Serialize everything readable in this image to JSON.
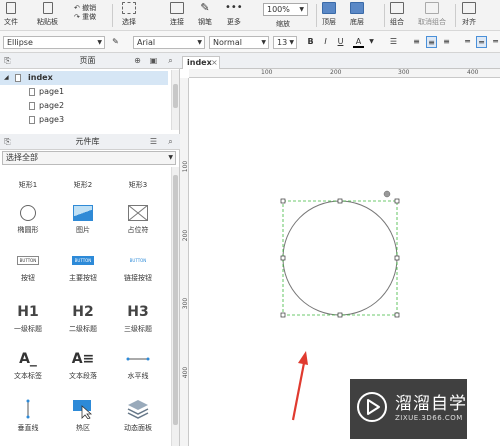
{
  "toolbar": {
    "file_label": "文件",
    "paste_label": "粘贴板",
    "undo_label": "撤销",
    "redo_label": "重做",
    "select_label": "选择",
    "connect_label": "连接",
    "pen_label": "钢笔",
    "more_label": "更多",
    "zoom_value": "100%",
    "zoom_label": "缩放",
    "top_label": "顶层",
    "bottom_label": "底层",
    "group_label": "组合",
    "ungroup_label": "取消组合",
    "align_label": "对齐"
  },
  "format": {
    "shape_name": "Ellipse",
    "font_family": "Arial",
    "font_weight": "Normal",
    "font_size": "13",
    "bold": "B",
    "italic": "I",
    "underline": "U",
    "font_color": "A"
  },
  "pages_panel": {
    "title": "页面",
    "root": "index",
    "pages": [
      "page1",
      "page2",
      "page3"
    ]
  },
  "library_panel": {
    "title": "元件库",
    "selector": "选择全部",
    "widgets": [
      {
        "label": "矩形1"
      },
      {
        "label": "矩形2"
      },
      {
        "label": "矩形3"
      },
      {
        "label": "椭圆形"
      },
      {
        "label": "图片"
      },
      {
        "label": "占位符"
      },
      {
        "label": "按钮",
        "inner": "BUTTON"
      },
      {
        "label": "主要按钮",
        "inner": "BUTTON"
      },
      {
        "label": "链接按钮",
        "inner": "BUTTON"
      },
      {
        "label": "一级标题",
        "inner": "H1"
      },
      {
        "label": "二级标题",
        "inner": "H2"
      },
      {
        "label": "三级标题",
        "inner": "H3"
      },
      {
        "label": "文本标签"
      },
      {
        "label": "文本段落"
      },
      {
        "label": "水平线"
      },
      {
        "label": "垂直线"
      },
      {
        "label": "热区"
      },
      {
        "label": "动态面板"
      }
    ]
  },
  "canvas": {
    "tab_label": "index",
    "tab_close": "×",
    "ruler_h": [
      "100",
      "200",
      "300",
      "400"
    ],
    "ruler_v": [
      "100",
      "200",
      "300",
      "400"
    ]
  },
  "watermark": {
    "cn": "溜溜自学",
    "url": "ZIXUE.3D66.COM"
  },
  "colors": {
    "selection": "#3db83d",
    "arrow": "#e03a2f",
    "primary_button": "#2d8ad8"
  }
}
